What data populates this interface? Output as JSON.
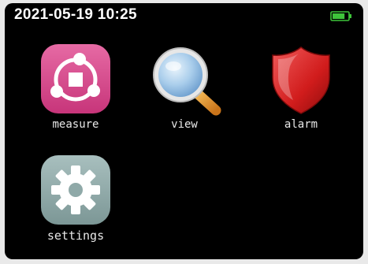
{
  "status_bar": {
    "datetime": "2021-05-19 10:25",
    "battery_level": 0.8,
    "battery_icon": "battery-icon"
  },
  "apps": {
    "measure": {
      "label": "measure",
      "icon": "measure-icon"
    },
    "view": {
      "label": "view",
      "icon": "magnifier-icon"
    },
    "alarm": {
      "label": "alarm",
      "icon": "shield-icon"
    },
    "settings": {
      "label": "settings",
      "icon": "gear-icon"
    }
  },
  "colors": {
    "screen_bg": "#000000",
    "text": "#ffffff",
    "battery": "#3ec43a",
    "measure": "#d6478a",
    "alarm": "#d92020",
    "settings": "#8fa9a8",
    "magnifier_lens": "#a9cdeb",
    "magnifier_handle": "#e89a2e"
  }
}
